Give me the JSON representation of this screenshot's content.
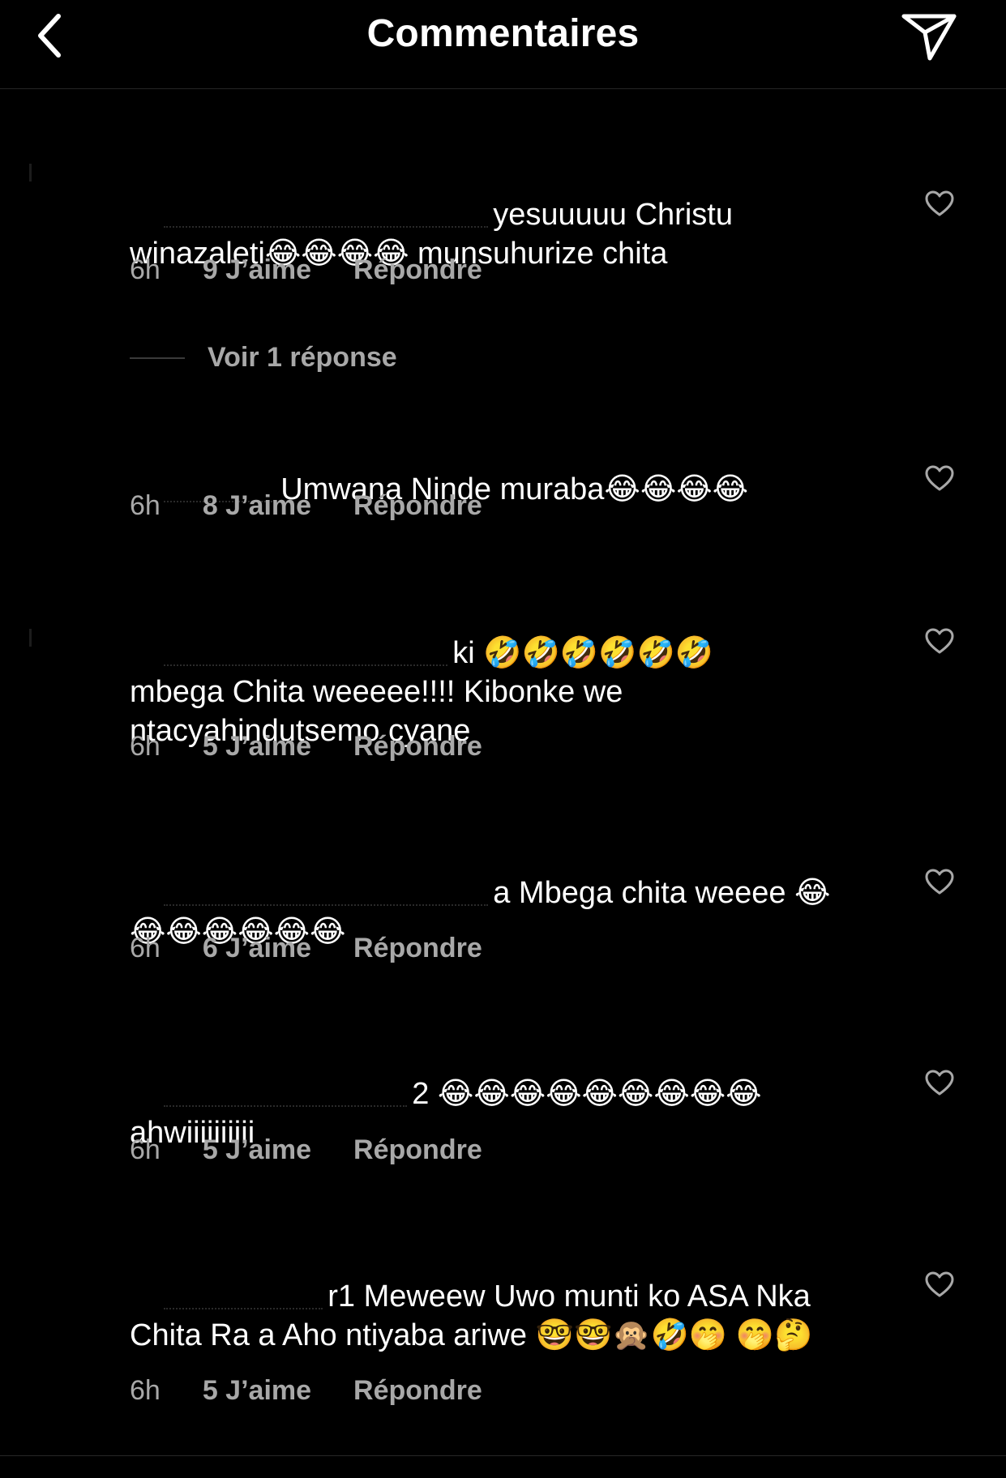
{
  "header": {
    "title": "Commentaires",
    "back_icon": "chevron-left-icon",
    "share_icon": "paper-plane-icon"
  },
  "colors": {
    "background": "#000000",
    "text": "#ffffff",
    "secondary_text": "#a8a8a8",
    "divider": "#262626"
  },
  "comments": [
    {
      "text_line1": "yesuuuuu Christu",
      "text_rest": "winazaleti😂😂😂😂 munsuhurize chita",
      "time": "6h",
      "likes": "9 J’aime",
      "reply": "Répondre",
      "view_replies": "Voir 1 réponse"
    },
    {
      "text_line1": "Umwana Ninde muraba😂😂😂😂",
      "text_rest": "",
      "time": "6h",
      "likes": "8 J’aime",
      "reply": "Répondre"
    },
    {
      "text_line1": "ki 🤣🤣🤣🤣🤣🤣",
      "text_rest": "mbega Chita weeeee!!!! Kibonke we ntacyahindutsemo cyane",
      "time": "6h",
      "likes": "5 J’aime",
      "reply": "Répondre"
    },
    {
      "text_line1": "a Mbega chita weeee 😂",
      "text_rest": "😂😂😂😂😂😂",
      "time": "6h",
      "likes": "6 J’aime",
      "reply": "Répondre"
    },
    {
      "text_line1": "2 😂😂😂😂😂😂😂😂😂",
      "text_rest": "ahwiiiiiiiiii",
      "time": "6h",
      "likes": "5 J’aime",
      "reply": "Répondre"
    },
    {
      "text_line1": "r1 Meweew Uwo munti ko ASA Nka",
      "text_rest": "Chita Ra a Aho ntiyaba ariwe 🤓🤓🙊🤣🤭 🤭🤔",
      "time": "6h",
      "likes": "5 J’aime",
      "reply": "Répondre"
    }
  ]
}
